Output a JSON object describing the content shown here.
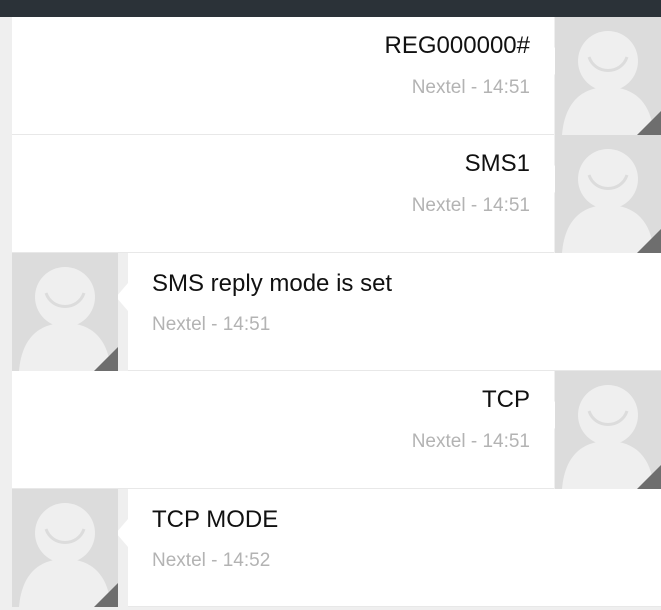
{
  "conversation": {
    "messages": [
      {
        "direction": "sent",
        "text": "REG000000#",
        "meta": "Nextel - 14:51"
      },
      {
        "direction": "sent",
        "text": "SMS1",
        "meta": "Nextel - 14:51"
      },
      {
        "direction": "received",
        "text": "SMS reply mode is set",
        "meta": "Nextel - 14:51"
      },
      {
        "direction": "sent",
        "text": "TCP",
        "meta": "Nextel - 14:51"
      },
      {
        "direction": "received",
        "text": "TCP MODE",
        "meta": "Nextel - 14:52"
      }
    ]
  },
  "colors": {
    "status_bar": "#2b3238",
    "bubble": "#ffffff",
    "avatar_bg": "#dcdcdc",
    "avatar_fg": "#efefef",
    "avatar_corner": "#6e6e6e",
    "meta_text": "#b3b3b3"
  },
  "icons": {
    "avatar": "default-contact-silhouette-icon"
  }
}
